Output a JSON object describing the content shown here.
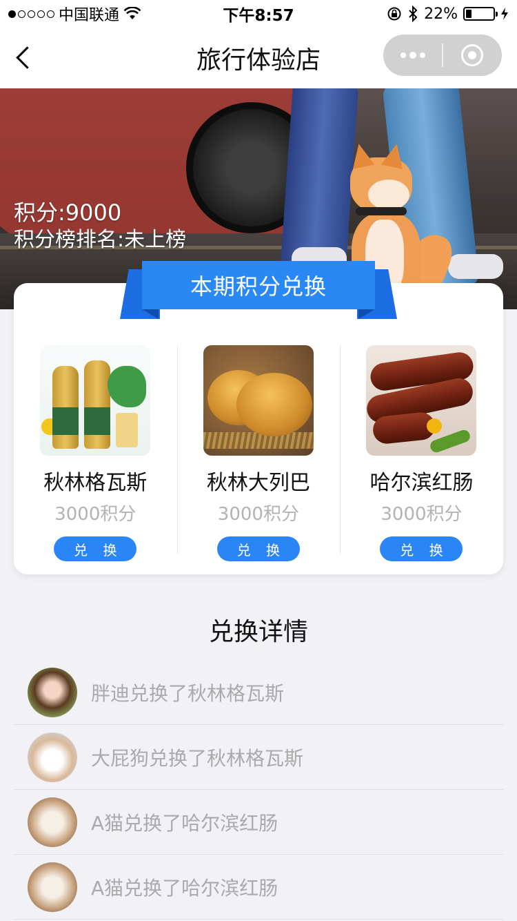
{
  "status_bar": {
    "carrier": "中国联通",
    "time": "下午8:57",
    "battery": "22%",
    "battery_level": 0.22,
    "signal_dots_filled": 1,
    "signal_dots_total": 5
  },
  "nav": {
    "title": "旅行体验店",
    "back_icon": "chevron-left-icon",
    "more_icon": "more-dots-icon",
    "close_icon": "target-circle-icon"
  },
  "banner": {
    "score_label": "积分:9000",
    "rank_label": "积分榜排名:未上榜"
  },
  "exchange": {
    "ribbon_title": "本期积分兑换",
    "products": [
      {
        "name": "秋林格瓦斯",
        "points": "3000积分",
        "button": "兑 换"
      },
      {
        "name": "秋林大列巴",
        "points": "3000积分",
        "button": "兑 换"
      },
      {
        "name": "哈尔滨红肠",
        "points": "3000积分",
        "button": "兑 换"
      }
    ]
  },
  "details": {
    "title": "兑换详情",
    "rows": [
      {
        "text": "胖迪兑换了秋林格瓦斯"
      },
      {
        "text": "大屁狗兑换了秋林格瓦斯"
      },
      {
        "text": "A猫兑换了哈尔滨红肠"
      },
      {
        "text": "A猫兑换了哈尔滨红肠"
      }
    ]
  },
  "colors": {
    "accent_blue": "#2a86f6",
    "ribbon_blue": "#2a88f5",
    "muted_text": "#aaaaaa",
    "page_bg": "#f2f2f6"
  }
}
